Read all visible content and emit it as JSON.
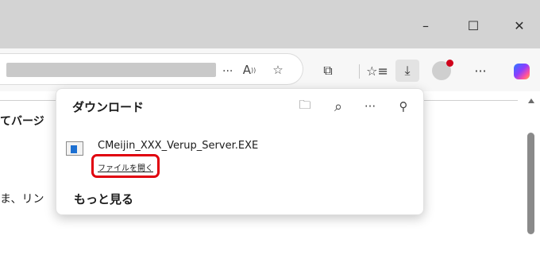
{
  "window": {
    "minimize_glyph": "–",
    "maximize_glyph": "☐",
    "close_glyph": "✕"
  },
  "toolbar": {
    "url_ellipsis": "...",
    "read_aloud_glyph": "A",
    "favorite_glyph": "☆",
    "extensions_glyph": "⧉",
    "favorites_glyph": "☆≡",
    "downloads_glyph": "⤓",
    "more_glyph": "···"
  },
  "page": {
    "line1": "てバージ",
    "line2": "ま、リン"
  },
  "downloads_panel": {
    "title": "ダウンロード",
    "open_folder_glyph": "🗀",
    "search_glyph": "⌕",
    "more_glyph": "···",
    "pin_glyph": "⚲",
    "items": [
      {
        "name": "CMeijin_XXX_Verup_Server.EXE",
        "action": "ファイルを開く"
      }
    ],
    "see_more": "もっと見る"
  },
  "colors": {
    "titlebar": "#d3d3d3",
    "highlight": "#e0000e",
    "avatar_badge": "#d0021b",
    "file_icon_blue": "#1c6fd1"
  }
}
